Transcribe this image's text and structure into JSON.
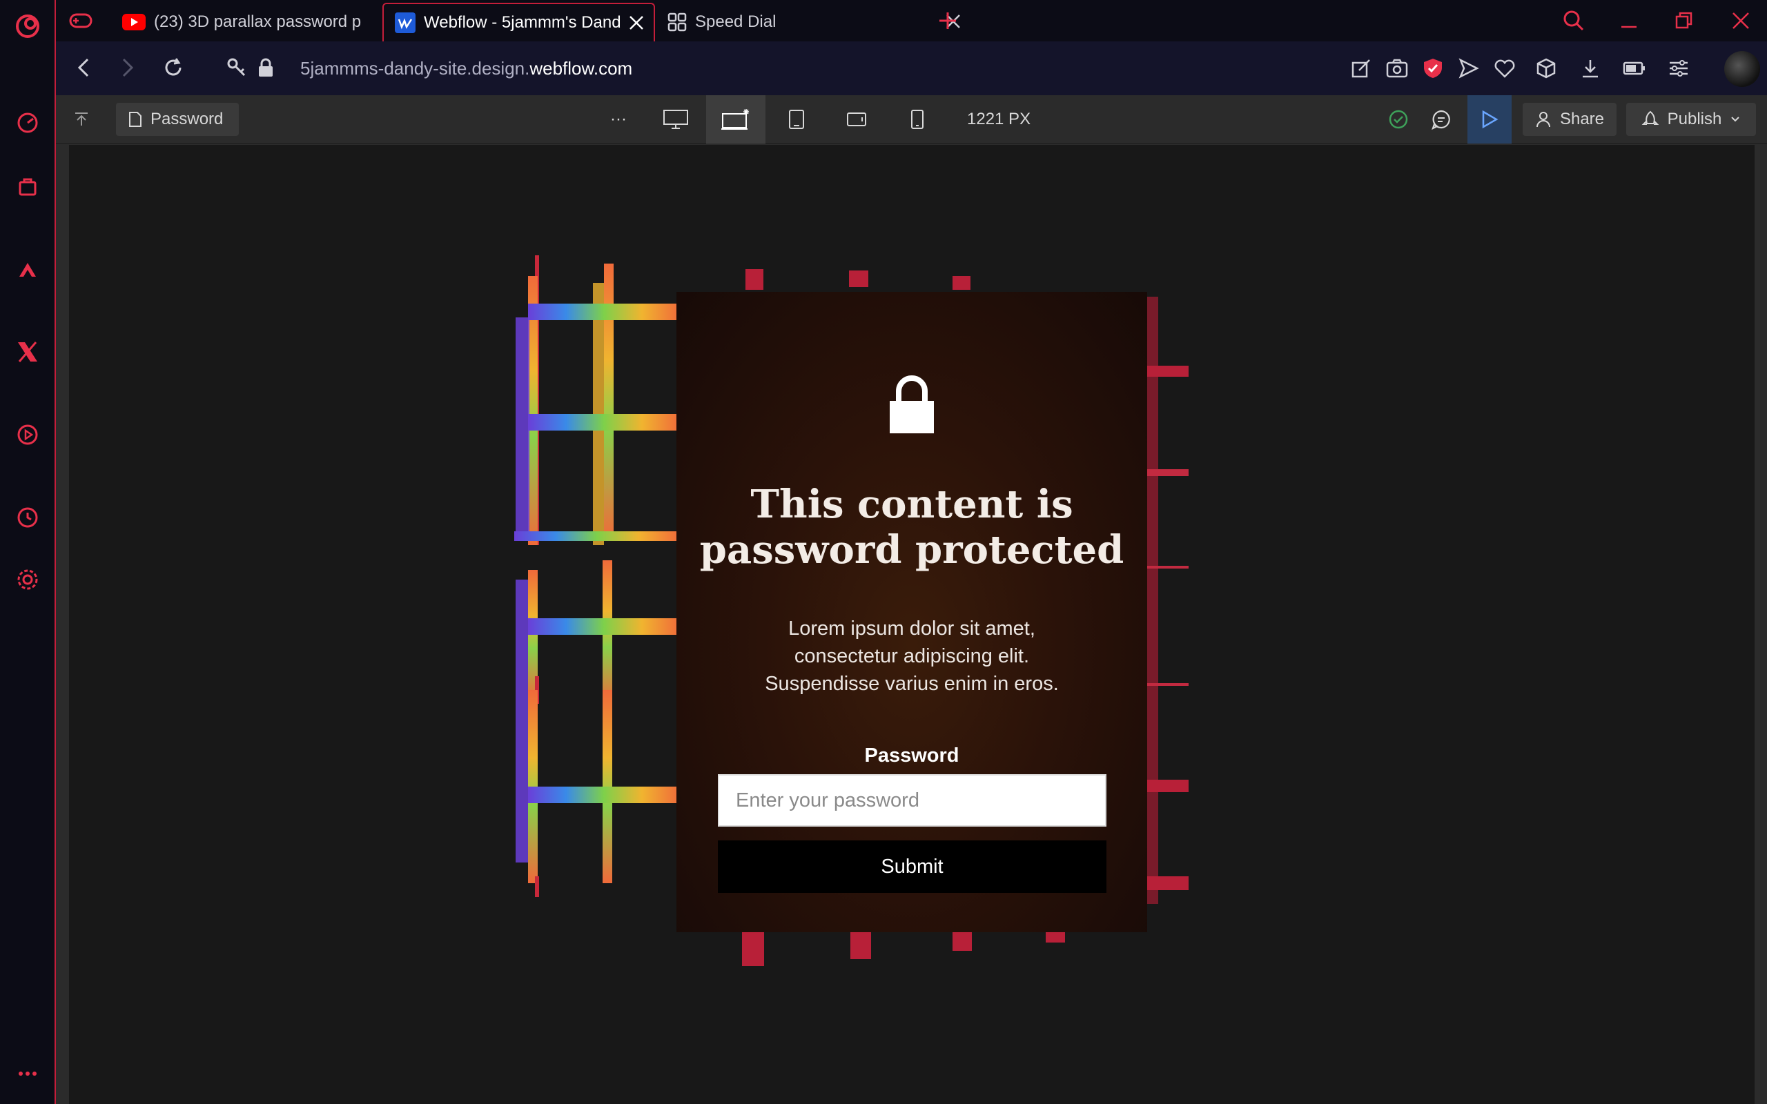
{
  "browser": {
    "tabs": [
      {
        "title": "(23) 3D parallax password p",
        "icon": "youtube-icon"
      },
      {
        "title": "Webflow - 5jammm's Dand",
        "icon": "webflow-icon",
        "active": true
      },
      {
        "title": "Speed Dial",
        "icon": "grid-icon"
      }
    ],
    "url": {
      "host_prefix": "5jammms-dandy-site.design.",
      "domain": "webflow.com"
    },
    "accent_color": "#c41e3a"
  },
  "webflow": {
    "page_label": "Password",
    "more_label": "···",
    "canvas_width": "1221 PX",
    "share_label": "Share",
    "publish_label": "Publish"
  },
  "page": {
    "title": "This content is password protected",
    "body": "Lorem ipsum dolor sit amet, consectetur adipiscing elit. Suspendisse varius enim in eros.",
    "password_label": "Password",
    "password_placeholder": "Enter your password",
    "submit_label": "Submit"
  }
}
